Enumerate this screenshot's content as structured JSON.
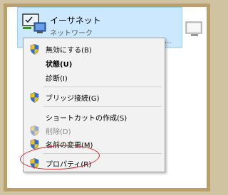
{
  "network_item": {
    "name": "イーサネット",
    "subtitle": "ネットワーク",
    "truncated_text": "C..."
  },
  "context_menu": {
    "items": [
      {
        "label": "無効にする(B)",
        "icon": "shield-icon",
        "bold": false,
        "disabled": false
      },
      {
        "label": "状態(U)",
        "icon": "",
        "bold": true,
        "disabled": false
      },
      {
        "label": "診断(I)",
        "icon": "",
        "bold": false,
        "disabled": false
      },
      {
        "label": "ブリッジ接続(G)",
        "icon": "shield-icon",
        "bold": false,
        "disabled": false
      },
      {
        "label": "ショートカットの作成(S)",
        "icon": "",
        "bold": false,
        "disabled": false
      },
      {
        "label": "削除(D)",
        "icon": "shield-icon",
        "bold": false,
        "disabled": true
      },
      {
        "label": "名前の変更(M)",
        "icon": "shield-icon",
        "bold": false,
        "disabled": false
      },
      {
        "label": "プロパティ(R)",
        "icon": "shield-icon",
        "bold": false,
        "disabled": false
      }
    ]
  },
  "colors": {
    "selection": "#cce8ff",
    "selection_border": "#99d1ff",
    "menu_bg": "#f2f2f2",
    "highlight_circle": "#c8282d",
    "frame": "#b99f6c"
  }
}
